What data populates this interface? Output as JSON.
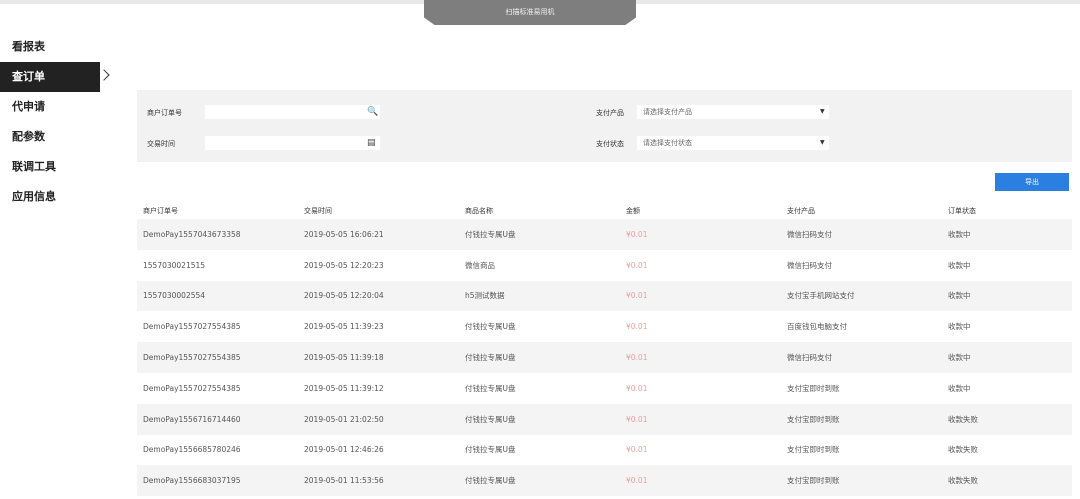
{
  "top_tab": {
    "label": "扫描标准易用机"
  },
  "sidebar": {
    "items": [
      {
        "label": "看报表"
      },
      {
        "label": "查订单"
      },
      {
        "label": "代申请"
      },
      {
        "label": "配参数"
      },
      {
        "label": "联调工具"
      },
      {
        "label": "应用信息"
      }
    ],
    "active_index": 1
  },
  "filter": {
    "order_no_label": "商户订单号",
    "order_no_value": "",
    "time_label": "交易时间",
    "time_value": "",
    "product_label": "支付产品",
    "product_placeholder": "请选择支付产品",
    "status_label": "支付状态",
    "status_placeholder": "请选择支付状态",
    "icons": {
      "search": "search-icon",
      "calendar": "calendar-icon",
      "dropdown": "dropdown-arrow-icon"
    }
  },
  "export_button": {
    "label": "导出"
  },
  "table": {
    "headers": [
      "商户订单号",
      "交易时间",
      "商品名称",
      "金额",
      "支付产品",
      "订单状态"
    ],
    "rows": [
      [
        "DemoPay1557043673358",
        "2019-05-05 16:06:21",
        "付钱拉专属U盘",
        "¥0.01",
        "微信扫码支付",
        "收款中"
      ],
      [
        "1557030021515",
        "2019-05-05 12:20:23",
        "微信商品",
        "¥0.01",
        "微信扫码支付",
        "收款中"
      ],
      [
        "1557030002554",
        "2019-05-05 12:20:04",
        "h5测试数据",
        "¥0.01",
        "支付宝手机网站支付",
        "收款中"
      ],
      [
        "DemoPay1557027554385",
        "2019-05-05 11:39:23",
        "付钱拉专属U盘",
        "¥0.01",
        "百度钱包电脑支付",
        "收款中"
      ],
      [
        "DemoPay1557027554385",
        "2019-05-05 11:39:18",
        "付钱拉专属U盘",
        "¥0.01",
        "微信扫码支付",
        "收款中"
      ],
      [
        "DemoPay1557027554385",
        "2019-05-05 11:39:12",
        "付钱拉专属U盘",
        "¥0.01",
        "支付宝即时到账",
        "收款中"
      ],
      [
        "DemoPay1556716714460",
        "2019-05-01 21:02:50",
        "付钱拉专属U盘",
        "¥0.01",
        "支付宝即时到账",
        "收款失败"
      ],
      [
        "DemoPay1556685780246",
        "2019-05-01 12:46:26",
        "付钱拉专属U盘",
        "¥0.01",
        "支付宝即时到账",
        "收款失败"
      ],
      [
        "DemoPay1556683037195",
        "2019-05-01 11:53:56",
        "付钱拉专属U盘",
        "¥0.01",
        "支付宝即时到账",
        "收款失败"
      ]
    ]
  },
  "colors": {
    "accent": "#2b7fe0",
    "sidebar_active": "#222222",
    "amount": "#e8a0a0"
  }
}
